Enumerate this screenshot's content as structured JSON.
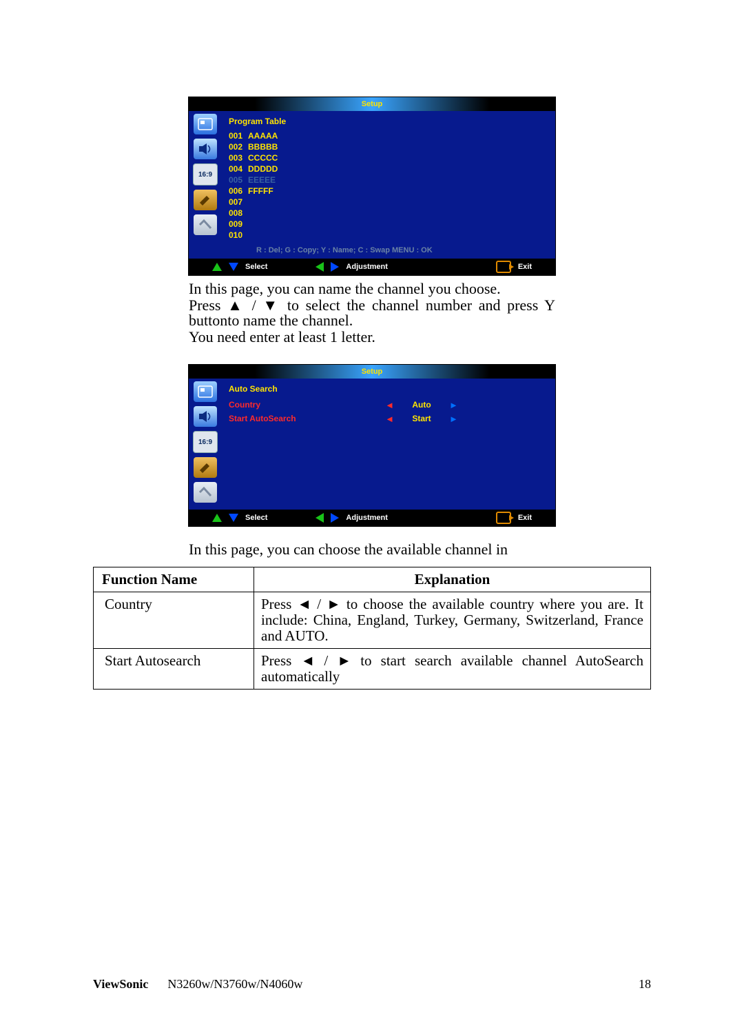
{
  "osd_common": {
    "title": "Setup",
    "nav": {
      "select": "Select",
      "adjustment": "Adjustment",
      "exit": "Exit"
    },
    "side_aspect": "16:9"
  },
  "osd1": {
    "heading": "Program Table",
    "rows": [
      {
        "num": "001",
        "name": "AAAAA"
      },
      {
        "num": "002",
        "name": "BBBBB"
      },
      {
        "num": "003",
        "name": "CCCCC"
      },
      {
        "num": "004",
        "name": "DDDDD"
      },
      {
        "num": "005",
        "name": "EEEEE"
      },
      {
        "num": "006",
        "name": "FFFFF"
      },
      {
        "num": "007",
        "name": ""
      },
      {
        "num": "008",
        "name": ""
      },
      {
        "num": "009",
        "name": ""
      },
      {
        "num": "010",
        "name": ""
      }
    ],
    "legend": "R : Del; G : Copy; Y : Name; C : Swap  MENU : OK"
  },
  "para1a": "In this page, you can name the channel you choose.",
  "para1b": "Press ▲ / ▼ to select the channel number and press Y buttonto name the channel.",
  "para1c": "You need enter at least 1 letter.",
  "osd2": {
    "heading": "Auto Search",
    "row1": {
      "label": "Country",
      "value": "Auto"
    },
    "row2": {
      "label": "Start AutoSearch",
      "value": "Start"
    }
  },
  "para2": "In this page, you can choose the available channel in",
  "table": {
    "h1": "Function Name",
    "h2": "Explanation",
    "r1f": "Country",
    "r1e": "Press ◄ / ► to choose the available country where you are. It include: China, England, Turkey, Germany, Switzerland, France and AUTO.",
    "r2f": "Start Autosearch",
    "r2e": "Press ◄ / ► to start search available channel AutoSearch automatically"
  },
  "footer": {
    "brand": "ViewSonic",
    "models": "N3260w/N3760w/N4060w",
    "page": "18"
  }
}
